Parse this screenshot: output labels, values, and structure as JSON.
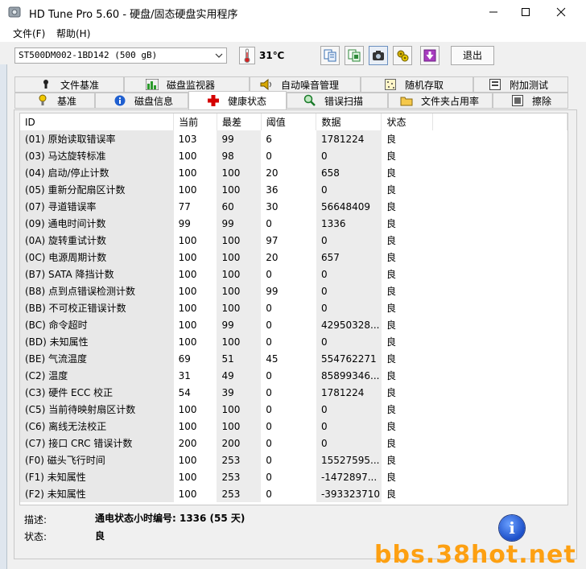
{
  "window": {
    "title": "HD Tune Pro 5.60 - 硬盘/固态硬盘实用程序",
    "minimize_icon": "minimize-icon",
    "maximize_icon": "maximize-icon",
    "close_icon": "close-icon"
  },
  "menu": {
    "file": "文件(F)",
    "help": "帮助(H)"
  },
  "toolbar": {
    "drive": "ST500DM002-1BD142 (500 gB)",
    "temperature": "31℃",
    "exit_label": "退出",
    "icons": [
      "copy-text-icon",
      "copy-screen-icon",
      "camera-icon",
      "settings-icon",
      "save-icon"
    ]
  },
  "tabs_top": [
    {
      "label": "文件基准",
      "icon": "file-benchmark-icon"
    },
    {
      "label": "磁盘监视器",
      "icon": "disk-monitor-icon"
    },
    {
      "label": "自动噪音管理",
      "icon": "speaker-icon"
    },
    {
      "label": "随机存取",
      "icon": "random-access-icon"
    },
    {
      "label": "附加测试",
      "icon": "extra-tests-icon"
    }
  ],
  "tabs_bottom": [
    {
      "label": "基准",
      "icon": "benchmark-icon"
    },
    {
      "label": "磁盘信息",
      "icon": "info-icon"
    },
    {
      "label": "健康状态",
      "icon": "health-icon"
    },
    {
      "label": "错误扫描",
      "icon": "error-scan-icon"
    },
    {
      "label": "文件夹占用率",
      "icon": "folder-icon"
    },
    {
      "label": "擦除",
      "icon": "erase-icon"
    }
  ],
  "table": {
    "headers": [
      "ID",
      "当前",
      "最差",
      "阈值",
      "数据",
      "状态"
    ],
    "rows": [
      [
        "(01) 原始读取错误率",
        "103",
        "99",
        "6",
        "1781224",
        "良"
      ],
      [
        "(03) 马达旋转标准",
        "100",
        "98",
        "0",
        "0",
        "良"
      ],
      [
        "(04) 启动/停止计数",
        "100",
        "100",
        "20",
        "658",
        "良"
      ],
      [
        "(05) 重新分配扇区计数",
        "100",
        "100",
        "36",
        "0",
        "良"
      ],
      [
        "(07) 寻道错误率",
        "77",
        "60",
        "30",
        "56648409",
        "良"
      ],
      [
        "(09) 通电时间计数",
        "99",
        "99",
        "0",
        "1336",
        "良"
      ],
      [
        "(0A) 旋转重试计数",
        "100",
        "100",
        "97",
        "0",
        "良"
      ],
      [
        "(0C) 电源周期计数",
        "100",
        "100",
        "20",
        "657",
        "良"
      ],
      [
        "(B7) SATA 降挡计数",
        "100",
        "100",
        "0",
        "0",
        "良"
      ],
      [
        "(B8) 点到点错误检测计数",
        "100",
        "100",
        "99",
        "0",
        "良"
      ],
      [
        "(BB) 不可校正错误计数",
        "100",
        "100",
        "0",
        "0",
        "良"
      ],
      [
        "(BC) 命令超时",
        "100",
        "99",
        "0",
        "42950328...",
        "良"
      ],
      [
        "(BD) 未知属性",
        "100",
        "100",
        "0",
        "0",
        "良"
      ],
      [
        "(BE) 气流温度",
        "69",
        "51",
        "45",
        "554762271",
        "良"
      ],
      [
        "(C2) 温度",
        "31",
        "49",
        "0",
        "85899346...",
        "良"
      ],
      [
        "(C3) 硬件 ECC 校正",
        "54",
        "39",
        "0",
        "1781224",
        "良"
      ],
      [
        "(C5) 当前待映射扇区计数",
        "100",
        "100",
        "0",
        "0",
        "良"
      ],
      [
        "(C6) 离线无法校正",
        "100",
        "100",
        "0",
        "0",
        "良"
      ],
      [
        "(C7) 接口 CRC 错误计数",
        "200",
        "200",
        "0",
        "0",
        "良"
      ],
      [
        "(F0) 磁头飞行时间",
        "100",
        "253",
        "0",
        "15527595...",
        "良"
      ],
      [
        "(F1) 未知属性",
        "100",
        "253",
        "0",
        "-1472897...",
        "良"
      ],
      [
        "(F2) 未知属性",
        "100",
        "253",
        "0",
        "-393323710",
        "良"
      ]
    ]
  },
  "footer": {
    "desc_label": "描述:",
    "desc_value": "通电状态小时编号: 1336 (55 天)",
    "status_label": "状态:",
    "status_value": "良"
  },
  "watermark": "bbs.38hot.net",
  "colors": {
    "watermark": "#ff9a00",
    "thermometer": "#d42020",
    "health_cross": "#d40000"
  }
}
